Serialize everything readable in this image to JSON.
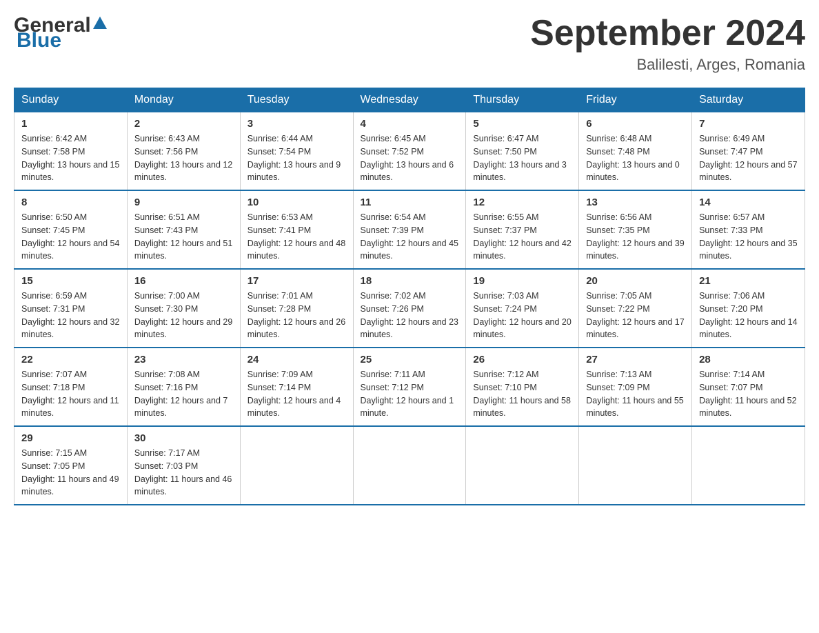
{
  "header": {
    "logo_general": "General",
    "logo_blue": "Blue",
    "month_title": "September 2024",
    "location": "Balilesti, Arges, Romania"
  },
  "weekdays": [
    "Sunday",
    "Monday",
    "Tuesday",
    "Wednesday",
    "Thursday",
    "Friday",
    "Saturday"
  ],
  "weeks": [
    [
      {
        "day": "1",
        "sunrise": "6:42 AM",
        "sunset": "7:58 PM",
        "daylight": "13 hours and 15 minutes."
      },
      {
        "day": "2",
        "sunrise": "6:43 AM",
        "sunset": "7:56 PM",
        "daylight": "13 hours and 12 minutes."
      },
      {
        "day": "3",
        "sunrise": "6:44 AM",
        "sunset": "7:54 PM",
        "daylight": "13 hours and 9 minutes."
      },
      {
        "day": "4",
        "sunrise": "6:45 AM",
        "sunset": "7:52 PM",
        "daylight": "13 hours and 6 minutes."
      },
      {
        "day": "5",
        "sunrise": "6:47 AM",
        "sunset": "7:50 PM",
        "daylight": "13 hours and 3 minutes."
      },
      {
        "day": "6",
        "sunrise": "6:48 AM",
        "sunset": "7:48 PM",
        "daylight": "13 hours and 0 minutes."
      },
      {
        "day": "7",
        "sunrise": "6:49 AM",
        "sunset": "7:47 PM",
        "daylight": "12 hours and 57 minutes."
      }
    ],
    [
      {
        "day": "8",
        "sunrise": "6:50 AM",
        "sunset": "7:45 PM",
        "daylight": "12 hours and 54 minutes."
      },
      {
        "day": "9",
        "sunrise": "6:51 AM",
        "sunset": "7:43 PM",
        "daylight": "12 hours and 51 minutes."
      },
      {
        "day": "10",
        "sunrise": "6:53 AM",
        "sunset": "7:41 PM",
        "daylight": "12 hours and 48 minutes."
      },
      {
        "day": "11",
        "sunrise": "6:54 AM",
        "sunset": "7:39 PM",
        "daylight": "12 hours and 45 minutes."
      },
      {
        "day": "12",
        "sunrise": "6:55 AM",
        "sunset": "7:37 PM",
        "daylight": "12 hours and 42 minutes."
      },
      {
        "day": "13",
        "sunrise": "6:56 AM",
        "sunset": "7:35 PM",
        "daylight": "12 hours and 39 minutes."
      },
      {
        "day": "14",
        "sunrise": "6:57 AM",
        "sunset": "7:33 PM",
        "daylight": "12 hours and 35 minutes."
      }
    ],
    [
      {
        "day": "15",
        "sunrise": "6:59 AM",
        "sunset": "7:31 PM",
        "daylight": "12 hours and 32 minutes."
      },
      {
        "day": "16",
        "sunrise": "7:00 AM",
        "sunset": "7:30 PM",
        "daylight": "12 hours and 29 minutes."
      },
      {
        "day": "17",
        "sunrise": "7:01 AM",
        "sunset": "7:28 PM",
        "daylight": "12 hours and 26 minutes."
      },
      {
        "day": "18",
        "sunrise": "7:02 AM",
        "sunset": "7:26 PM",
        "daylight": "12 hours and 23 minutes."
      },
      {
        "day": "19",
        "sunrise": "7:03 AM",
        "sunset": "7:24 PM",
        "daylight": "12 hours and 20 minutes."
      },
      {
        "day": "20",
        "sunrise": "7:05 AM",
        "sunset": "7:22 PM",
        "daylight": "12 hours and 17 minutes."
      },
      {
        "day": "21",
        "sunrise": "7:06 AM",
        "sunset": "7:20 PM",
        "daylight": "12 hours and 14 minutes."
      }
    ],
    [
      {
        "day": "22",
        "sunrise": "7:07 AM",
        "sunset": "7:18 PM",
        "daylight": "12 hours and 11 minutes."
      },
      {
        "day": "23",
        "sunrise": "7:08 AM",
        "sunset": "7:16 PM",
        "daylight": "12 hours and 7 minutes."
      },
      {
        "day": "24",
        "sunrise": "7:09 AM",
        "sunset": "7:14 PM",
        "daylight": "12 hours and 4 minutes."
      },
      {
        "day": "25",
        "sunrise": "7:11 AM",
        "sunset": "7:12 PM",
        "daylight": "12 hours and 1 minute."
      },
      {
        "day": "26",
        "sunrise": "7:12 AM",
        "sunset": "7:10 PM",
        "daylight": "11 hours and 58 minutes."
      },
      {
        "day": "27",
        "sunrise": "7:13 AM",
        "sunset": "7:09 PM",
        "daylight": "11 hours and 55 minutes."
      },
      {
        "day": "28",
        "sunrise": "7:14 AM",
        "sunset": "7:07 PM",
        "daylight": "11 hours and 52 minutes."
      }
    ],
    [
      {
        "day": "29",
        "sunrise": "7:15 AM",
        "sunset": "7:05 PM",
        "daylight": "11 hours and 49 minutes."
      },
      {
        "day": "30",
        "sunrise": "7:17 AM",
        "sunset": "7:03 PM",
        "daylight": "11 hours and 46 minutes."
      },
      null,
      null,
      null,
      null,
      null
    ]
  ]
}
